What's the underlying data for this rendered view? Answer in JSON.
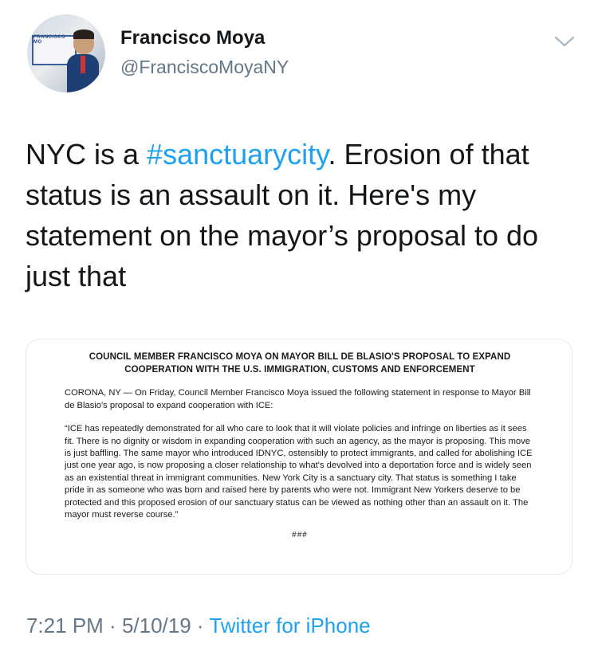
{
  "author": {
    "display_name": "Francisco Moya",
    "handle": "@FranciscoMoyaNY",
    "avatar_sign_text": "FRANCISCO MO"
  },
  "tweet": {
    "text_before": "NYC is a ",
    "hashtag": "#sanctuarycity",
    "text_after": ". Erosion of that status is an assault on it. Here's my statement on the mayor’s proposal to do just that"
  },
  "statement": {
    "title": "COUNCIL MEMBER FRANCISCO MOYA ON MAYOR BILL DE BLASIO'S PROPOSAL TO EXPAND COOPERATION WITH THE U.S. IMMIGRATION, CUSTOMS AND ENFORCEMENT",
    "intro": "CORONA, NY — On Friday, Council Member Francisco Moya issued the following statement in response to Mayor Bill de Blasio's proposal to expand cooperation with ICE:",
    "quote": "“ICE has repeatedly demonstrated for all who care to look that it will violate policies and infringe on liberties as it sees fit. There is no dignity or wisdom in expanding cooperation with such an agency, as the mayor is proposing. This move is just baffling. The same mayor who introduced IDNYC, ostensibly to protect immigrants, and called for abolishing ICE just one year ago, is now proposing a closer relationship to what's devolved into a deportation force and is widely seen as an existential threat in immigrant communities. New York City is a sanctuary city. That status is something I take pride in as someone who was born and raised here by parents who were not. Immigrant New Yorkers deserve to be protected and this proposed erosion of our sanctuary status can be viewed as nothing other than an assault on it. The mayor must reverse course.”",
    "end_mark": "###"
  },
  "footer": {
    "time": "7:21 PM",
    "sep1": " · ",
    "date": "5/10/19",
    "sep2": " · ",
    "source": "Twitter for iPhone"
  },
  "icons": {
    "menu": "chevron-down-icon"
  },
  "colors": {
    "link": "#1da1f2",
    "secondary_text": "#657786",
    "primary_text": "#14171a",
    "card_border": "#e1e8ed"
  }
}
